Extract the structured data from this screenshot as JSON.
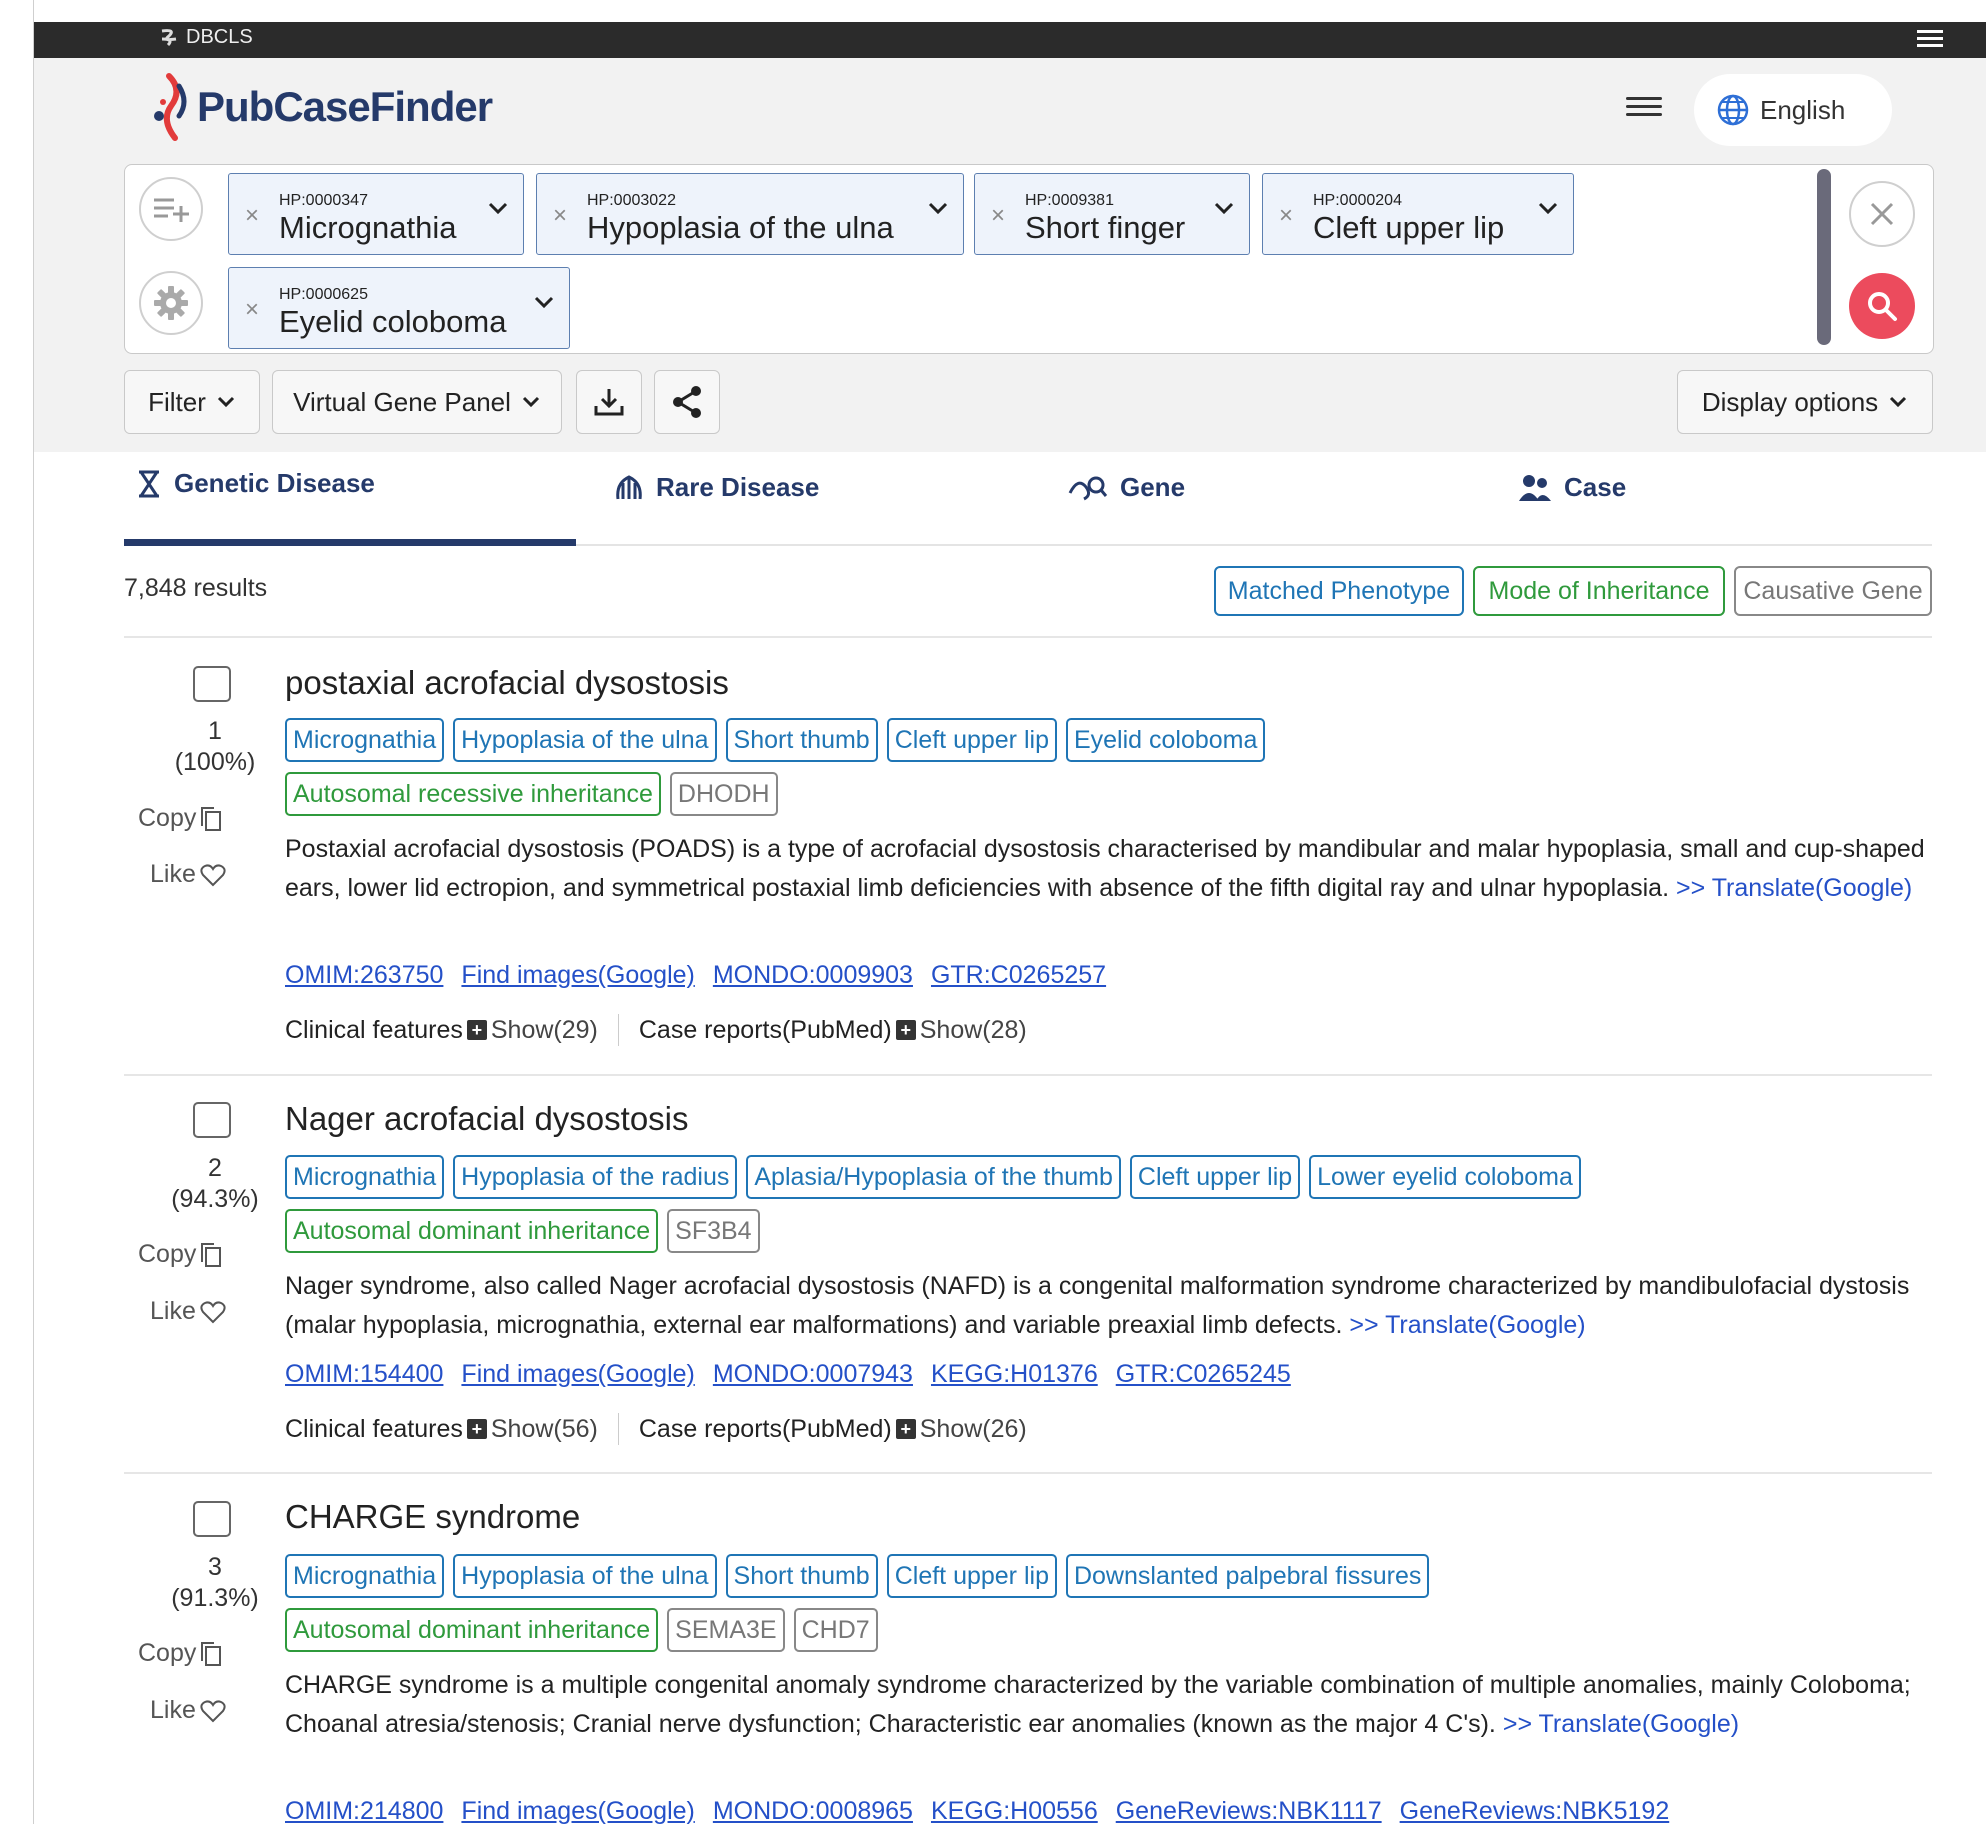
{
  "topbar": {
    "brand": "DBCLS",
    "menu_icon": "hamburger-icon"
  },
  "header": {
    "app_name": "PubCaseFinder",
    "language": "English"
  },
  "query": {
    "chips": [
      {
        "id": "HP:0000347",
        "label": "Micrognathia"
      },
      {
        "id": "HP:0003022",
        "label": "Hypoplasia of the ulna"
      },
      {
        "id": "HP:0009381",
        "label": "Short finger"
      },
      {
        "id": "HP:0000204",
        "label": "Cleft upper lip"
      },
      {
        "id": "HP:0000625",
        "label": "Eyelid coloboma"
      }
    ]
  },
  "toolbar": {
    "filter": "Filter",
    "virtual_gene_panel": "Virtual Gene Panel",
    "display_options": "Display options"
  },
  "tabs": [
    {
      "label": "Genetic Disease",
      "active": true
    },
    {
      "label": "Rare Disease"
    },
    {
      "label": "Gene"
    },
    {
      "label": "Case"
    }
  ],
  "results_count": "7,848 results",
  "legend": {
    "phenotype": "Matched Phenotype",
    "inheritance": "Mode of Inheritance",
    "gene": "Causative Gene"
  },
  "colors": {
    "brand_navy": "#253a6a",
    "phenotype": "#1f75b5",
    "inheritance": "#2f9a3c",
    "gene": "#888888",
    "search": "#ec4b5d",
    "link": "#2450c8"
  },
  "side_labels": {
    "copy": "Copy",
    "like": "Like"
  },
  "results": [
    {
      "rank": "1",
      "score": "(100%)",
      "title": "postaxial acrofacial dysostosis",
      "phenotypes": [
        "Micrognathia",
        "Hypoplasia of the ulna",
        "Short thumb",
        "Cleft upper lip",
        "Eyelid coloboma"
      ],
      "inheritance": "Autosomal recessive inheritance",
      "genes": [
        "DHODH"
      ],
      "description": "Postaxial acrofacial dysostosis (POADS) is a type of acrofacial dysostosis characterised by mandibular and malar hypoplasia, small and cup-shaped ears, lower lid ectropion, and symmetrical postaxial limb deficiencies with absence of the fifth digital ray and ulnar hypoplasia.",
      "translate": ">> Translate(Google)",
      "links": [
        "OMIM:263750",
        "Find images(Google)",
        "MONDO:0009903",
        "GTR:C0265257"
      ],
      "clinical_label": "Clinical features",
      "clinical_show": "Show(29)",
      "case_label": "Case reports(PubMed)",
      "case_show": "Show(28)"
    },
    {
      "rank": "2",
      "score": "(94.3%)",
      "title": "Nager acrofacial dysostosis",
      "phenotypes": [
        "Micrognathia",
        "Hypoplasia of the radius",
        "Aplasia/Hypoplasia of the thumb",
        "Cleft upper lip",
        "Lower eyelid coloboma"
      ],
      "inheritance": "Autosomal dominant inheritance",
      "genes": [
        "SF3B4"
      ],
      "description": "Nager syndrome, also called Nager acrofacial dysostosis (NAFD) is a congenital malformation syndrome characterized by mandibulofacial dystosis (malar hypoplasia, micrognathia, external ear malformations) and variable preaxial limb defects.",
      "translate": ">> Translate(Google)",
      "links": [
        "OMIM:154400",
        "Find images(Google)",
        "MONDO:0007943",
        "KEGG:H01376",
        "GTR:C0265245"
      ],
      "clinical_label": "Clinical features",
      "clinical_show": "Show(56)",
      "case_label": "Case reports(PubMed)",
      "case_show": "Show(26)"
    },
    {
      "rank": "3",
      "score": "(91.3%)",
      "title": "CHARGE syndrome",
      "phenotypes": [
        "Micrognathia",
        "Hypoplasia of the ulna",
        "Short thumb",
        "Cleft upper lip",
        "Downslanted palpebral fissures"
      ],
      "inheritance": "Autosomal dominant inheritance",
      "genes": [
        "SEMA3E",
        "CHD7"
      ],
      "description": "CHARGE syndrome is a multiple congenital anomaly syndrome characterized by the variable combination of multiple anomalies, mainly Coloboma; Choanal atresia/stenosis; Cranial nerve dysfunction; Characteristic ear anomalies (known as the major 4 C's).",
      "translate": ">> Translate(Google)",
      "links": [
        "OMIM:214800",
        "Find images(Google)",
        "MONDO:0008965",
        "KEGG:H00556",
        "GeneReviews:NBK1117",
        "GeneReviews:NBK5192"
      ]
    }
  ]
}
